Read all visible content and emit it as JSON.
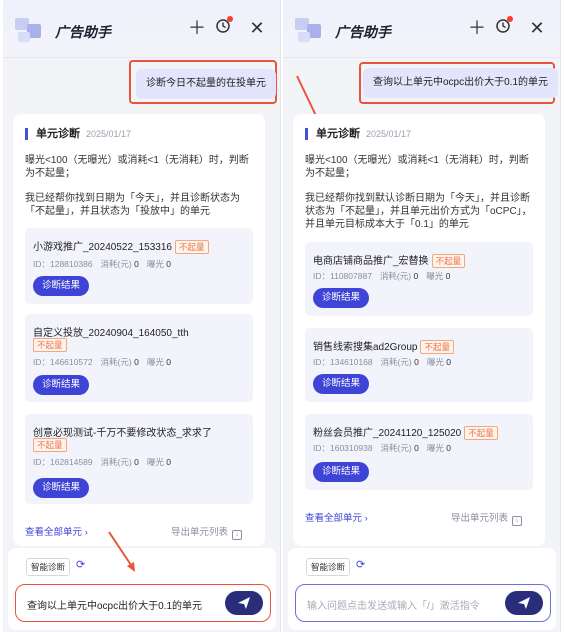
{
  "app": {
    "title": "广告助手"
  },
  "left": {
    "user_message": "诊断今日不起量的在投单元",
    "section_title": "单元诊断",
    "section_date": "2025/01/17",
    "rule_text": "曝光<100（无曝光）或消耗<1（无消耗）时，判断为不起量；",
    "found_text": "我已经帮你找到日期为「今天」，并且诊断状态为「不起量」，并且状态为「投放中」的单元",
    "units": [
      {
        "name": "小游戏推广_20240522_153316",
        "tag": "不起量",
        "id": "ID：128810386",
        "cost_label": "消耗(元)",
        "cost": "0",
        "exposure_label": "曝光",
        "exposure": "0",
        "button": "诊断结果"
      },
      {
        "name": "自定义投放_20240904_164050_tth",
        "tag": "不起量",
        "id": "ID：146610572",
        "cost_label": "消耗(元)",
        "cost": "0",
        "exposure_label": "曝光",
        "exposure": "0",
        "button": "诊断结果"
      },
      {
        "name": "创意必现测试-千万不要修改状态_求求了",
        "tag": "不起量",
        "id": "ID：162814589",
        "cost_label": "消耗(元)",
        "cost": "0",
        "exposure_label": "曝光",
        "exposure": "0",
        "button": "诊断结果"
      }
    ],
    "view_all": "查看全部单元",
    "export": "导出单元列表",
    "chip": "智能诊断",
    "input_value": "查询以上单元中ocpc出价大于0.1的单元"
  },
  "right": {
    "user_message": "查询以上单元中ocpc出价大于0.1的单元",
    "section_title": "单元诊断",
    "section_date": "2025/01/17",
    "rule_text": "曝光<100（无曝光）或消耗<1（无消耗）时，判断为不起量；",
    "found_text": "我已经帮你找到默认诊断日期为「今天」，并且诊断状态为「不起量」，并且单元出价方式为「oCPC」，并且单元目标成本大于「0.1」的单元",
    "units": [
      {
        "name": "电商店铺商品推广_宏替换",
        "tag": "不起量",
        "id": "ID：110807887",
        "cost_label": "消耗(元)",
        "cost": "0",
        "exposure_label": "曝光",
        "exposure": "0",
        "button": "诊断结果"
      },
      {
        "name": "销售线索搜集ad2Group",
        "tag": "不起量",
        "id": "ID：134610168",
        "cost_label": "消耗(元)",
        "cost": "0",
        "exposure_label": "曝光",
        "exposure": "0",
        "button": "诊断结果"
      },
      {
        "name": "粉丝会员推广_20241120_125020",
        "tag": "不起量",
        "id": "ID：160310938",
        "cost_label": "消耗(元)",
        "cost": "0",
        "exposure_label": "曝光",
        "exposure": "0",
        "button": "诊断结果"
      }
    ],
    "view_all": "查看全部单元",
    "export": "导出单元列表",
    "chip": "智能诊断",
    "input_placeholder": "输入问题点击发送或输入「/」激活指令"
  },
  "colors": {
    "accent": "#3e44d6",
    "tag": "#e8774a",
    "annotation_arrow": "#e9543a",
    "highlight_box": "#e9543a"
  },
  "icons": {
    "add": "plus-icon",
    "history": "clock-icon",
    "close": "close-icon",
    "send": "send-icon",
    "refresh": "refresh-icon"
  }
}
